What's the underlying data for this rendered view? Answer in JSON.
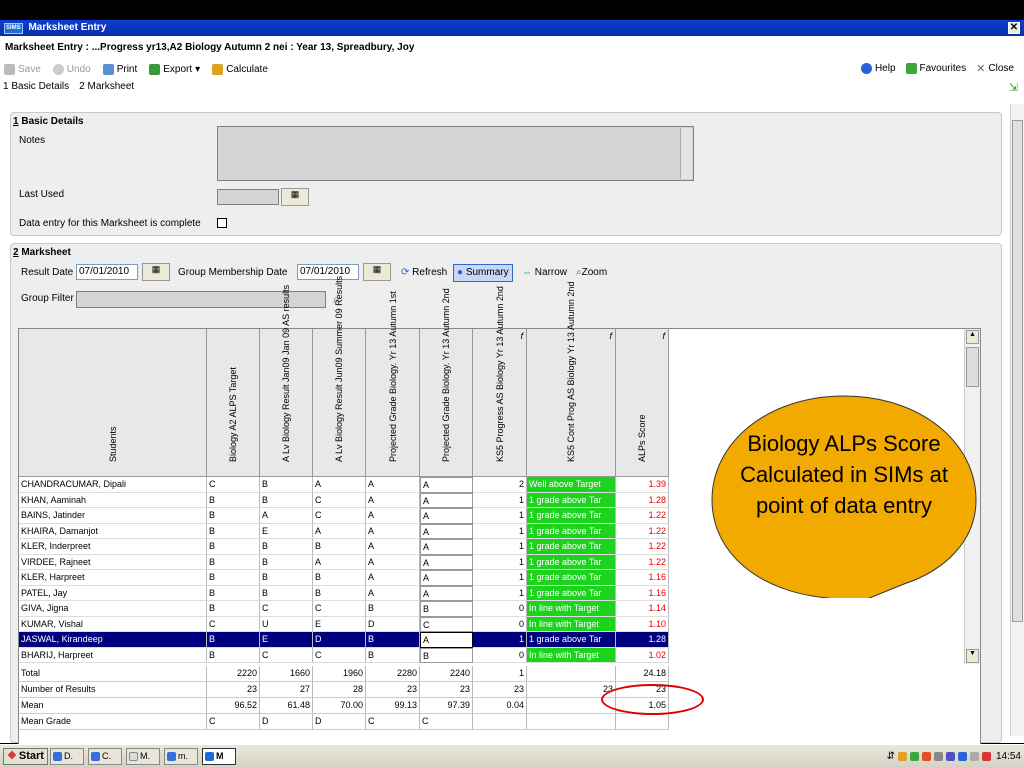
{
  "window": {
    "title": "Marksheet Entry",
    "logo": "SIMS",
    "close": "✕"
  },
  "heading": "Marksheet Entry : ...Progress yr13,A2 Biology Autumn 2 nei : Year 13, Spreadbury, Joy",
  "toolbar": {
    "save": "Save",
    "undo": "Undo",
    "print": "Print",
    "export": "Export",
    "calculate": "Calculate",
    "help": "Help",
    "favourites": "Favourites",
    "close": "Close"
  },
  "tabs": [
    {
      "num": "1",
      "label": "Basic Details"
    },
    {
      "num": "2",
      "label": "Marksheet"
    }
  ],
  "basic": {
    "title_num": "1",
    "title": "Basic Details",
    "notes_label": "Notes",
    "last_used_label": "Last Used",
    "complete_label": "Data entry for this Marksheet is complete"
  },
  "marksheet": {
    "title_num": "2",
    "title": "Marksheet",
    "result_date_label": "Result Date",
    "result_date": "07/01/2010",
    "group_date_label": "Group Membership Date",
    "group_date": "07/01/2010",
    "refresh": "Refresh",
    "summary": "Summary",
    "narrow": "Narrow",
    "zoom": "Zoom",
    "group_filter_label": "Group Filter"
  },
  "grid": {
    "columns": [
      "Students",
      "Biology A2 ALPS Target",
      "A Lv Biology Result Jan09 Jan 09 AS results",
      "A Lv Biology Result Jun09 Summer 09 Results",
      "Projected Grade Biology. Yr 13 Autumn 1st",
      "Projected Grade Biology. Yr 13 Autumn 2nd",
      "KS5 Progress AS Biology Yr 13 Autumn 2nd",
      "KS5 Cont Prog AS Biology Yr 13 Autumn 2nd",
      "ALPs Score"
    ],
    "formula_mark": "f",
    "rows": [
      {
        "name": "CHANDRACUMAR, Dipali",
        "target": "C",
        "jan": "B",
        "jun": "A",
        "p1": "A",
        "p2": "A",
        "prog": "2",
        "cont": "Well above Target",
        "alps": "1.39"
      },
      {
        "name": "KHAN, Aaminah",
        "target": "B",
        "jan": "B",
        "jun": "C",
        "p1": "A",
        "p2": "A",
        "prog": "1",
        "cont": "1 grade above Tar",
        "alps": "1.28"
      },
      {
        "name": "BAINS, Jatinder",
        "target": "B",
        "jan": "A",
        "jun": "C",
        "p1": "A",
        "p2": "A",
        "prog": "1",
        "cont": "1 grade above Tar",
        "alps": "1.22"
      },
      {
        "name": "KHAIRA, Damanjot",
        "target": "B",
        "jan": "E",
        "jun": "A",
        "p1": "A",
        "p2": "A",
        "prog": "1",
        "cont": "1 grade above Tar",
        "alps": "1.22"
      },
      {
        "name": "KLER, Inderpreet",
        "target": "B",
        "jan": "B",
        "jun": "B",
        "p1": "A",
        "p2": "A",
        "prog": "1",
        "cont": "1 grade above Tar",
        "alps": "1.22"
      },
      {
        "name": "VIRDEE, Rajneet",
        "target": "B",
        "jan": "B",
        "jun": "A",
        "p1": "A",
        "p2": "A",
        "prog": "1",
        "cont": "1 grade above Tar",
        "alps": "1.22"
      },
      {
        "name": "KLER, Harpreet",
        "target": "B",
        "jan": "B",
        "jun": "B",
        "p1": "A",
        "p2": "A",
        "prog": "1",
        "cont": "1 grade above Tar",
        "alps": "1.16"
      },
      {
        "name": "PATEL, Jay",
        "target": "B",
        "jan": "B",
        "jun": "B",
        "p1": "A",
        "p2": "A",
        "prog": "1",
        "cont": "1 grade above Tar",
        "alps": "1.16"
      },
      {
        "name": "GIVA, Jigna",
        "target": "B",
        "jan": "C",
        "jun": "C",
        "p1": "B",
        "p2": "B",
        "prog": "0",
        "cont": "In line with Target",
        "alps": "1.14"
      },
      {
        "name": "KUMAR, Vishal",
        "target": "C",
        "jan": "U",
        "jun": "E",
        "p1": "D",
        "p2": "C",
        "prog": "0",
        "cont": "In line with Target",
        "alps": "1.10"
      },
      {
        "name": "JASWAL, Kirandeep",
        "target": "B",
        "jan": "E",
        "jun": "D",
        "p1": "B",
        "p2": "A",
        "prog": "1",
        "cont": "1 grade above Tar",
        "alps": "1.28",
        "selected": true
      },
      {
        "name": "BHARIJ, Harpreet",
        "target": "B",
        "jan": "C",
        "jun": "C",
        "p1": "B",
        "p2": "B",
        "prog": "0",
        "cont": "In line with Target",
        "alps": "1.02"
      }
    ],
    "summary": [
      {
        "label": "Total",
        "target": "2220",
        "jan": "1660",
        "jun": "1960",
        "p1": "2280",
        "p2": "2240",
        "prog": "1",
        "cont": "",
        "alps": "24.18"
      },
      {
        "label": "Number of Results",
        "target": "23",
        "jan": "27",
        "jun": "28",
        "p1": "23",
        "p2": "23",
        "prog": "23",
        "cont": "23",
        "alps": "23"
      },
      {
        "label": "Mean",
        "target": "96.52",
        "jan": "61.48",
        "jun": "70.00",
        "p1": "99.13",
        "p2": "97.39",
        "prog": "0.04",
        "cont": "",
        "alps": "1.05"
      },
      {
        "label": "Mean Grade",
        "target": "C",
        "jan": "D",
        "jun": "D",
        "p1": "C",
        "p2": "C",
        "prog": "",
        "cont": "",
        "alps": ""
      }
    ]
  },
  "callout": {
    "text": "Biology ALPs Score Calculated in SIMs at point of data entry"
  },
  "taskbar": {
    "start": "Start",
    "tasks": [
      "D.",
      "C.",
      "M.",
      "m.",
      "M"
    ],
    "clock": "14:54"
  },
  "colors": {
    "green": "#1ed31e",
    "red": "#e00000",
    "selected": "#00007f",
    "callout": "#f2a900"
  }
}
